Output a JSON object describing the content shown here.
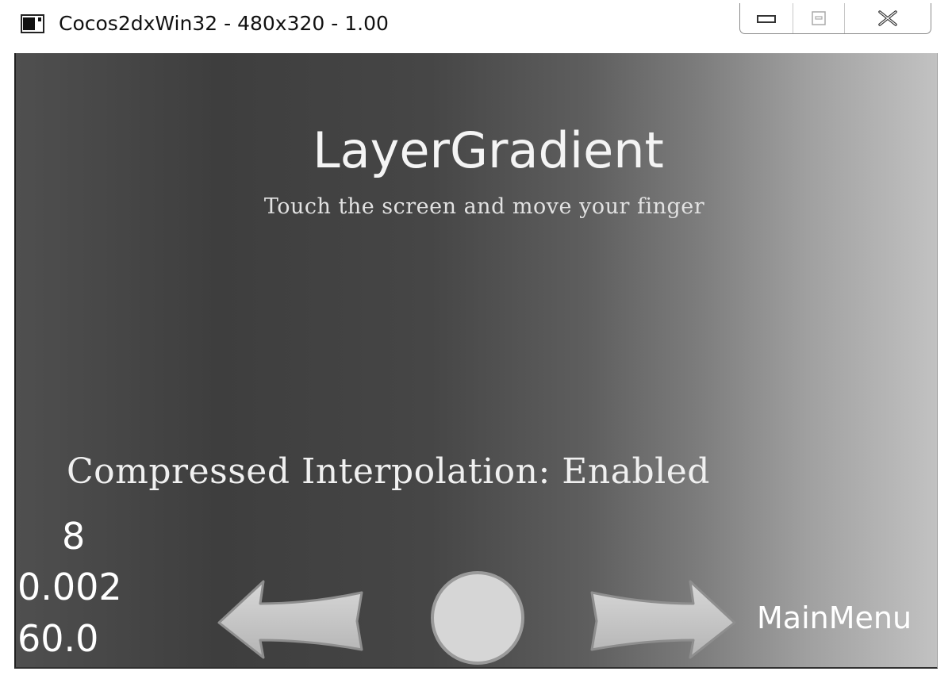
{
  "window": {
    "title": "Cocos2dxWin32 - 480x320 - 1.00",
    "icon": "app-window-icon",
    "controls": [
      "minimize-icon",
      "maximize-icon",
      "close-icon"
    ]
  },
  "scene": {
    "title": "LayerGradient",
    "subtitle": "Touch the screen and move your finger",
    "status": "Compressed Interpolation: Enabled",
    "stats": {
      "draw_calls": "8",
      "seconds_per_frame": "0.002",
      "fps": "60.0"
    },
    "menu": {
      "back": "back-arrow-icon",
      "restart": "restart-icon",
      "next": "next-arrow-icon",
      "main_menu_label": "MainMenu"
    },
    "colors": {
      "gradient_start": "#3e3e3e",
      "gradient_end": "#c2c2c2",
      "text": "#ffffff"
    }
  }
}
